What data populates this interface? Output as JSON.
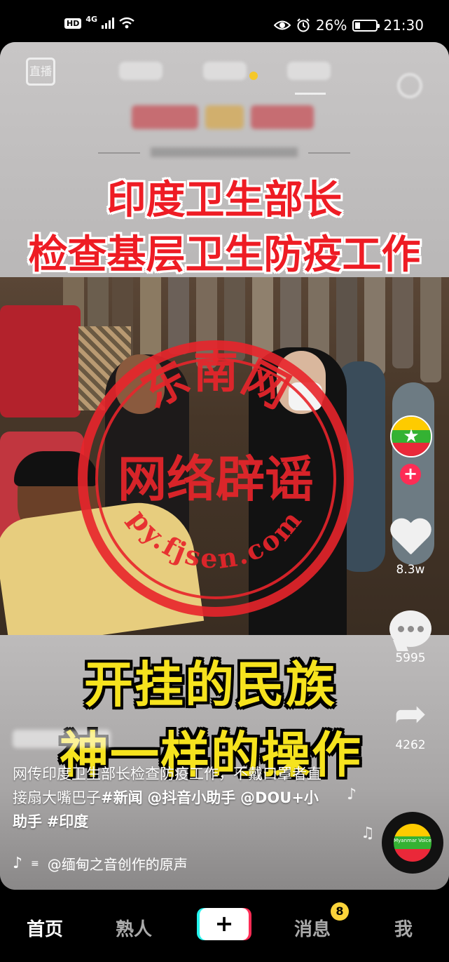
{
  "status_bar": {
    "hd": "HD",
    "network": "4G",
    "battery_percent": "26%",
    "time": "21:30",
    "battery_level": 0.26
  },
  "inner_video": {
    "live_label": "直播",
    "headline_line1": "印度卫生部长",
    "headline_line2": "检查基层卫生防疫工作",
    "stamp_top": "东南网",
    "stamp_center": "网络辟谣",
    "stamp_bottom": "py.fjsen.com",
    "overlay_line1": "开挂的民族",
    "overlay_line2": "神一样的操作"
  },
  "caption": {
    "text_plain": "网传印度卫生部长检查防疫工作，不戴口罩者直接扇大嘴巴子",
    "tag_news": "#新闻",
    "mention1": "@抖音小助手",
    "mention2": "@DOU+小助手",
    "tag_india": "#印度",
    "music": "@缅甸之音创作的原声"
  },
  "actions": {
    "like_count": "8.3w",
    "comment_count": "5995",
    "share_count": "4262",
    "follow_symbol": "+",
    "disc_label": "Myanmar Voice"
  },
  "bottom_nav": {
    "home": "首页",
    "friends": "熟人",
    "plus": "+",
    "messages": "消息",
    "messages_badge": "8",
    "me": "我"
  },
  "colors": {
    "brand_red": "#fe2c55",
    "brand_cyan": "#25f4ee",
    "headline_red": "#ee1c24",
    "overlay_yellow": "#f6e31e",
    "badge_yellow": "#fbd43a"
  }
}
